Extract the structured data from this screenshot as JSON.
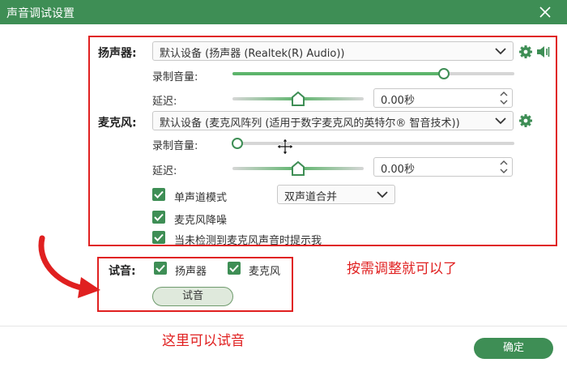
{
  "window": {
    "title": "声音调试设置",
    "close_label": "✕"
  },
  "speaker": {
    "label": "扬声器:",
    "device": "默认设备 (扬声器 (Realtek(R) Audio))",
    "record_volume_label": "录制音量:",
    "volume_fraction": 0.75,
    "delay_label": "延迟:",
    "delay_fraction": 0.5,
    "delay_value": "0.00秒"
  },
  "mic": {
    "label": "麦克风:",
    "device": "默认设备 (麦克风阵列 (适用于数字麦克风的英特尔® 智音技术))",
    "record_volume_label": "录制音量:",
    "volume_fraction": 0.0,
    "delay_label": "延迟:",
    "delay_fraction": 0.5,
    "delay_value": "0.00秒",
    "mono_label": "单声道模式",
    "mono_checked": true,
    "channel_mode": "双声道合并",
    "noise_label": "麦克风降噪",
    "noise_checked": true,
    "notify_label": "当未检测到麦克风声音时提示我",
    "notify_checked": true
  },
  "test": {
    "label": "试音:",
    "speaker_label": "扬声器",
    "speaker_checked": true,
    "mic_label": "麦克风",
    "mic_checked": true,
    "button_label": "试音"
  },
  "footer": {
    "ok_label": "确定"
  },
  "annotations": {
    "adjust": "按需调整就可以了",
    "try_here": "这里可以试音"
  },
  "colors": {
    "accent": "#3e8e55",
    "slider_fill": "#5cb46b",
    "annotation": "#e02020"
  }
}
